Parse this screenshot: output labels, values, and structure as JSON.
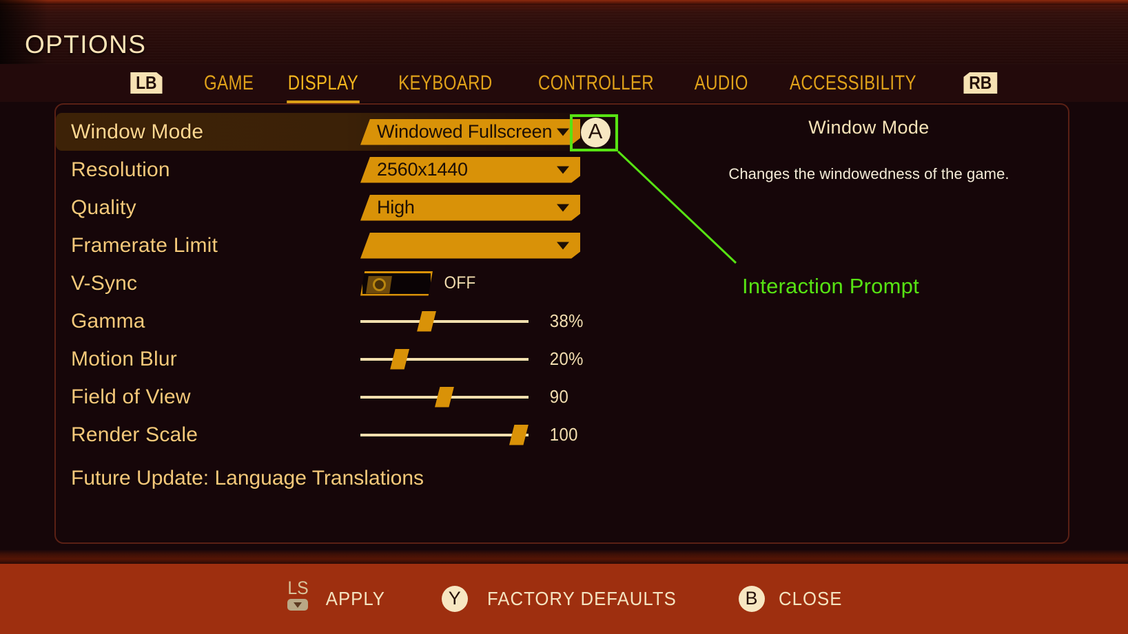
{
  "header": {
    "title": "OPTIONS"
  },
  "tabs": {
    "left_bumper": "LB",
    "right_bumper": "RB",
    "items": [
      {
        "label": "GAME",
        "active": false
      },
      {
        "label": "DISPLAY",
        "active": true
      },
      {
        "label": "KEYBOARD",
        "active": false
      },
      {
        "label": "CONTROLLER",
        "active": false
      },
      {
        "label": "AUDIO",
        "active": false
      },
      {
        "label": "ACCESSIBILITY",
        "active": false
      }
    ]
  },
  "settings": [
    {
      "label": "Window Mode",
      "type": "dropdown",
      "value": "Windowed Fullscreen",
      "selected": true,
      "prompt": "A"
    },
    {
      "label": "Resolution",
      "type": "dropdown",
      "value": "2560x1440",
      "selected": false
    },
    {
      "label": "Quality",
      "type": "dropdown",
      "value": "High",
      "selected": false
    },
    {
      "label": "Framerate Limit",
      "type": "dropdown",
      "value": "",
      "selected": false
    },
    {
      "label": "V-Sync",
      "type": "toggle",
      "value": "OFF",
      "on": false,
      "selected": false
    },
    {
      "label": "Gamma",
      "type": "slider",
      "value": "38%",
      "percent": 38,
      "selected": false
    },
    {
      "label": "Motion Blur",
      "type": "slider",
      "value": "20%",
      "percent": 20,
      "selected": false
    },
    {
      "label": "Field of View",
      "type": "slider",
      "value": "90",
      "percent": 50,
      "selected": false
    },
    {
      "label": "Render Scale",
      "type": "slider",
      "value": "100",
      "percent": 100,
      "selected": false
    }
  ],
  "future_note": "Future Update: Language Translations",
  "description": {
    "title": "Window Mode",
    "body": "Changes the windowedness of the game."
  },
  "annotation": {
    "label": "Interaction Prompt",
    "color": "#57e313"
  },
  "bottom_actions": [
    {
      "icon": "LS",
      "icon_type": "stick",
      "label": "APPLY"
    },
    {
      "icon": "Y",
      "icon_type": "circle",
      "label": "FACTORY DEFAULTS"
    },
    {
      "icon": "B",
      "icon_type": "circle",
      "label": "CLOSE"
    }
  ],
  "colors": {
    "gold": "#d99208",
    "cream": "#f3deb0",
    "rust": "#9e2f0f",
    "accent_green": "#57e313"
  }
}
